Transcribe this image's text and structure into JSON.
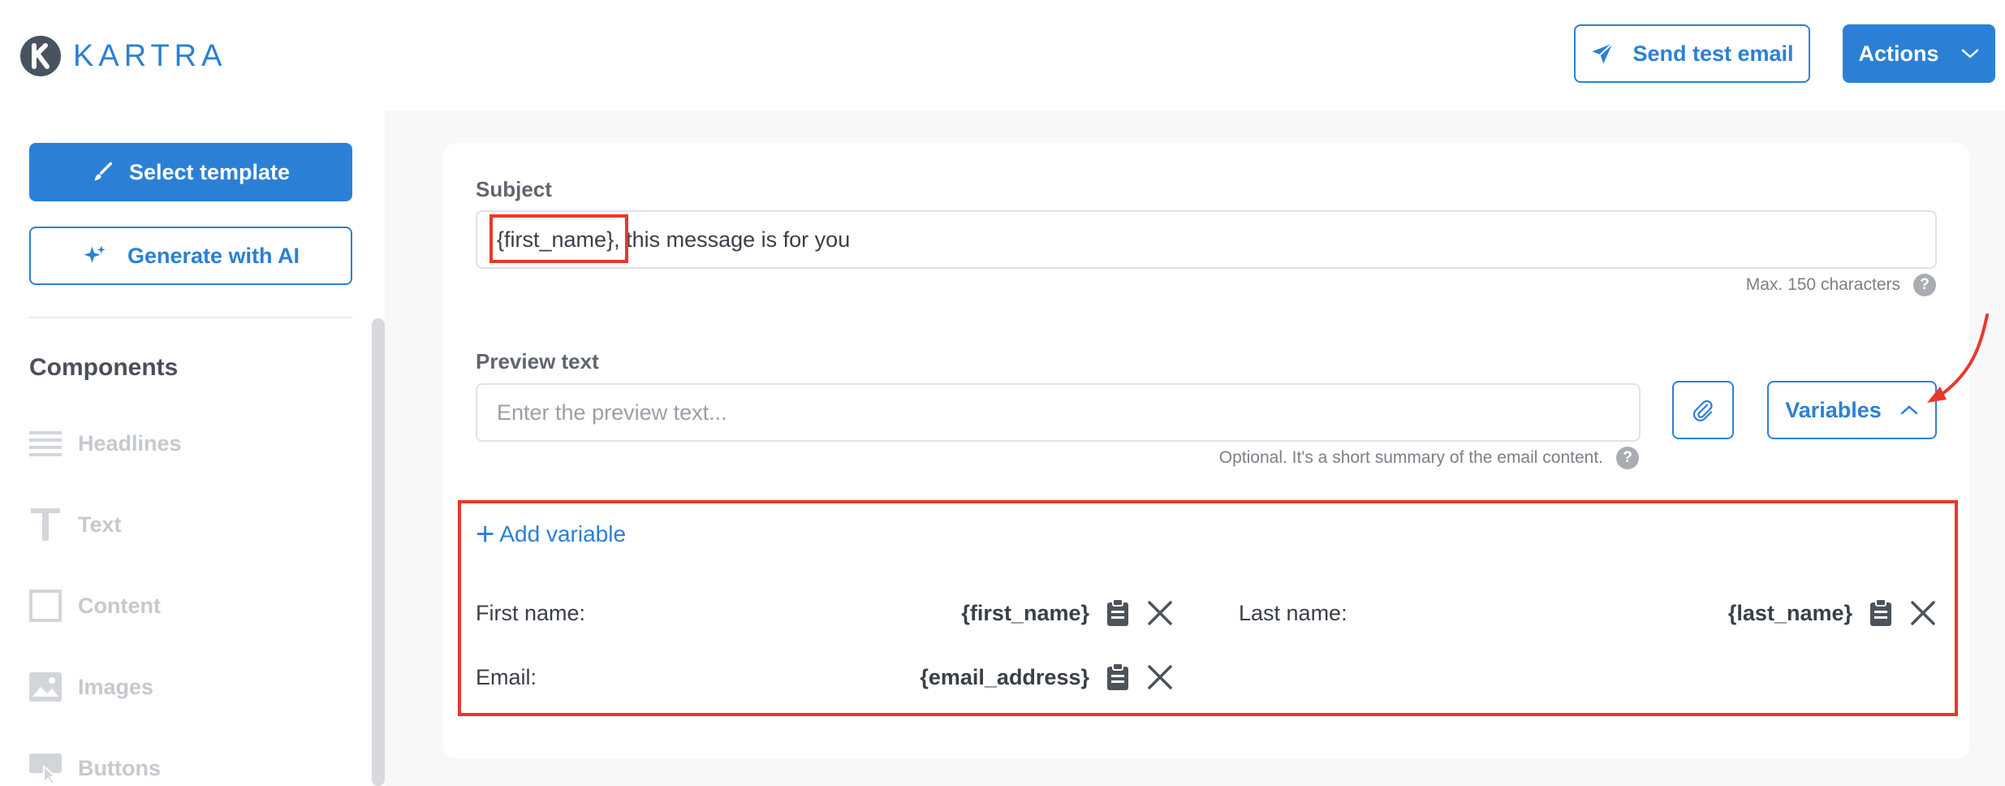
{
  "header": {
    "brand": "KARTRA",
    "send_test_label": "Send test email",
    "actions_label": "Actions"
  },
  "sidebar": {
    "select_template_label": "Select template",
    "generate_ai_label": "Generate with AI",
    "components_title": "Components",
    "components": [
      {
        "label": "Headlines",
        "icon": "headlines-icon"
      },
      {
        "label": "Text",
        "icon": "text-icon"
      },
      {
        "label": "Content",
        "icon": "content-icon"
      },
      {
        "label": "Images",
        "icon": "images-icon"
      },
      {
        "label": "Buttons",
        "icon": "buttons-icon"
      }
    ]
  },
  "form": {
    "subject_label": "Subject",
    "subject_value": "{first_name}, this message is for you",
    "subject_helper": "Max. 150 characters",
    "preview_label": "Preview text",
    "preview_placeholder": "Enter the preview text...",
    "preview_helper": "Optional. It's a short summary of the email content.",
    "variables_label": "Variables"
  },
  "variables": {
    "add_label": "Add variable",
    "items": [
      {
        "label": "First name:",
        "token": "{first_name}"
      },
      {
        "label": "Last name:",
        "token": "{last_name}"
      },
      {
        "label": "Email:",
        "token": "{email_address}"
      }
    ]
  },
  "colors": {
    "accent": "#2b80d6",
    "highlight": "#e8382b",
    "disabled": "#c5c9cf"
  }
}
